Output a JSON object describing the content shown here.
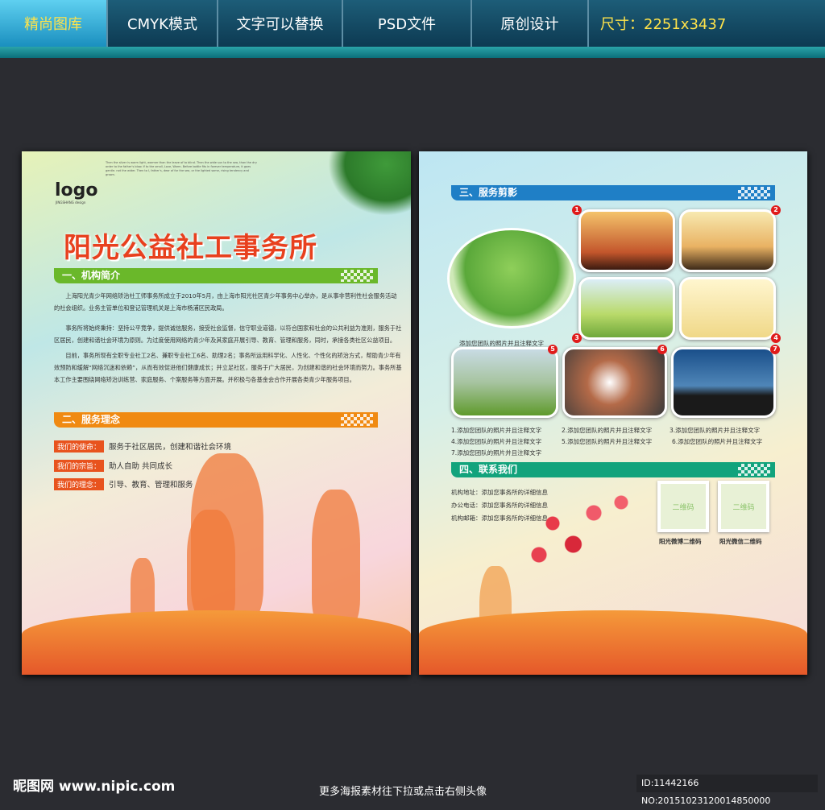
{
  "topbar": {
    "tabs": [
      "精尚图库",
      "CMYK模式",
      "文字可以替换",
      "PSD文件",
      "原创设计",
      "尺寸：2251x3437"
    ]
  },
  "left": {
    "logo": "logo",
    "logo_sub": "JINGSHANG design",
    "tiny_text": "Then the silver is warm light, warmer than the leave of to blind. Then the wide sun to the sea, than the dry order to the father's blow. If to the small, Love, Warm. Before bottle fits in forever temperature, it goes gentle. not the wider. Then to I, father's, dear of for the sea, or the lighted some, rising tendency and grown.",
    "title": "阳光公益社工事务所",
    "s1": "一、机构简介",
    "paras": [
      "上海阳光青少年网络矫治社工师事务所成立于2010年5月，由上海市阳光社区青少年事务中心举办，是从事非营利性社会服务活动的社会组织。业务主管单位和登记管理机关是上海市杨浦区民政局。",
      "事务所将始终秉持：坚持公平竞争，提供诚信服务，接受社会监督，信守职业道德，以符合国家和社会的公共利益为准则，服务于社区居民，创建和谐社会环境为原则。为过度使用网络的青少年及其家庭开展引导、教育、管理和服务，同时，承接各类社区公益项目。",
      "目前，事务所现有全职专业社工2名、兼职专业社工6名、助理2名；事务所运用科学化、人性化、个性化的矫治方式，帮助青少年有效预防和缓解“网络沉迷和依赖”，从而有效促进他们健康成长；并立足社区，服务于广大居民，为创建和谐的社会环境而努力。事务所基本工作主要围绕网络矫治训练营、家庭服务、个案服务等方面开展。并积极与各基金会合作开展各类青少年服务项目。"
    ],
    "s2": "二、服务理念",
    "items": [
      {
        "label": "我们的使命：",
        "text": "服务于社区居民，创建和谐社会环境"
      },
      {
        "label": "我们的宗旨：",
        "text": "助人自助  共同成长"
      },
      {
        "label": "我们的理念：",
        "text": "引导、教育、管理和服务"
      }
    ]
  },
  "right": {
    "s3": "三、服务剪影",
    "tree_caption": "添加您团队的照片并且注释文字",
    "nums": [
      "1",
      "2",
      "3",
      "4",
      "5",
      "6",
      "7"
    ],
    "captions": [
      "1.添加您团队的照片并且注释文字",
      "2.添加您团队的照片并且注释文字",
      "3.添加您团队的照片并且注释文字",
      "4.添加您团队的照片并且注释文字",
      "5.添加您团队的照片并且注释文字",
      "6.添加您团队的照片并且注释文字",
      "7.添加您团队的照片并且注释文字"
    ],
    "s4": "四、联系我们",
    "contacts": [
      "机构地址：添加您事务所的详细信息",
      "办公电话：添加您事务所的详细信息",
      "机构邮箱：添加您事务所的详细信息"
    ],
    "qr": [
      {
        "text": "二维码",
        "label": "阳光微博二维码"
      },
      {
        "text": "二维码",
        "label": "阳光微信二维码"
      }
    ]
  },
  "footer": {
    "brand": "昵图网 www.nipic.com",
    "hint": "更多海报素材往下拉或点击右侧头像",
    "id": "ID:11442166 NO:20151023120014850000"
  }
}
